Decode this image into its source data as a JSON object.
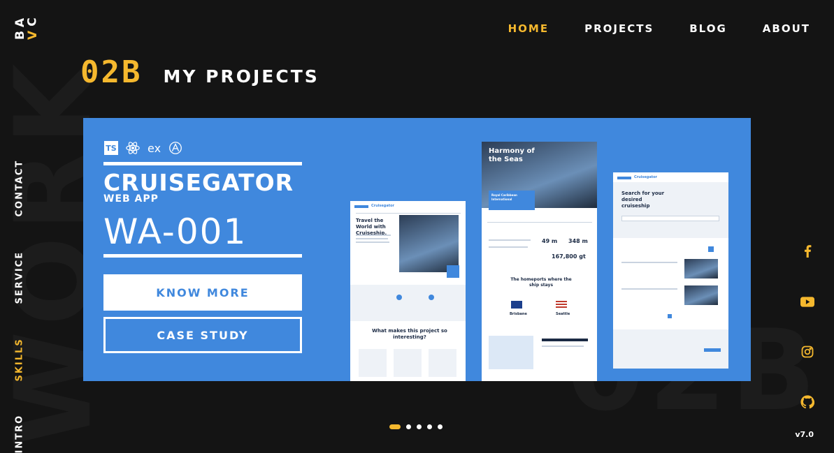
{
  "logo": {
    "letters": [
      "A",
      "C",
      "B",
      "V"
    ],
    "accent": "#f5b82e"
  },
  "nav": {
    "items": [
      "HOME",
      "PROJECTS",
      "BLOG",
      "ABOUT"
    ],
    "active_index": 0
  },
  "side_nav": {
    "items": [
      "CONTACT",
      "SERVICE",
      "SKILLS",
      "INTRO"
    ],
    "active": "SKILLS"
  },
  "background_words": {
    "vertical": "WORK",
    "horizontal": "02B"
  },
  "heading": {
    "number": "02B",
    "title": "MY PROJECTS"
  },
  "project": {
    "tech_icons": [
      "typescript-icon",
      "react-icon",
      "express-icon",
      "apollo-icon"
    ],
    "express_label": "ex",
    "ts_label": "TS",
    "name": "CRUISEGATOR",
    "type": "WEB APP",
    "code": "WA-001",
    "buttons": {
      "know_more": "KNOW MORE",
      "case_study": "CASE STUDY"
    },
    "previews": {
      "left": {
        "brand": "Cruisegator",
        "headline": "Travel the World with Cruiseship.",
        "section": "What makes this project so interesting?"
      },
      "center": {
        "headline": "Harmony of the Seas",
        "subtitle": "Royal Caribbean International",
        "section": "The homeports where the ship stays",
        "ports": [
          "Brisbane",
          "Seattle"
        ],
        "stats": [
          "49 m",
          "348 m",
          "167,800 gt"
        ]
      },
      "right": {
        "brand": "Cruisegator",
        "headline": "Search for your desired cruiseship"
      }
    },
    "background": "#4088dd"
  },
  "socials": [
    "facebook-icon",
    "youtube-icon",
    "instagram-icon",
    "github-icon"
  ],
  "carousel": {
    "count": 5,
    "active_index": 0
  },
  "version": "v7.0"
}
